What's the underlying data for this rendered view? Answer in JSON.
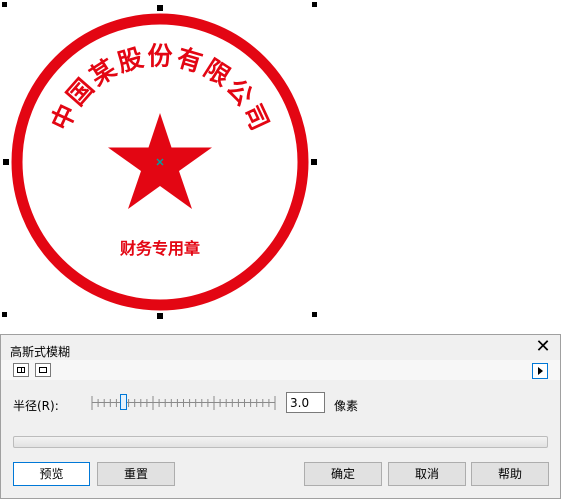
{
  "seal": {
    "company_name": "中国某股份有限公司",
    "company_chars": [
      "中",
      "国",
      "某",
      "股",
      "份",
      "有",
      "限",
      "公",
      "司"
    ],
    "department": "财务专用章",
    "color": "#e30613"
  },
  "dialog": {
    "title": "高斯式模糊",
    "close_glyph": "✕",
    "radius_label": "半径(R):",
    "radius_value": "3.0",
    "radius_unit": "像素",
    "radius_slider_position": 0.17,
    "buttons": {
      "preview": "预览",
      "reset": "重置",
      "ok": "确定",
      "cancel": "取消",
      "help": "帮助"
    },
    "accent_color": "#0078d7"
  }
}
